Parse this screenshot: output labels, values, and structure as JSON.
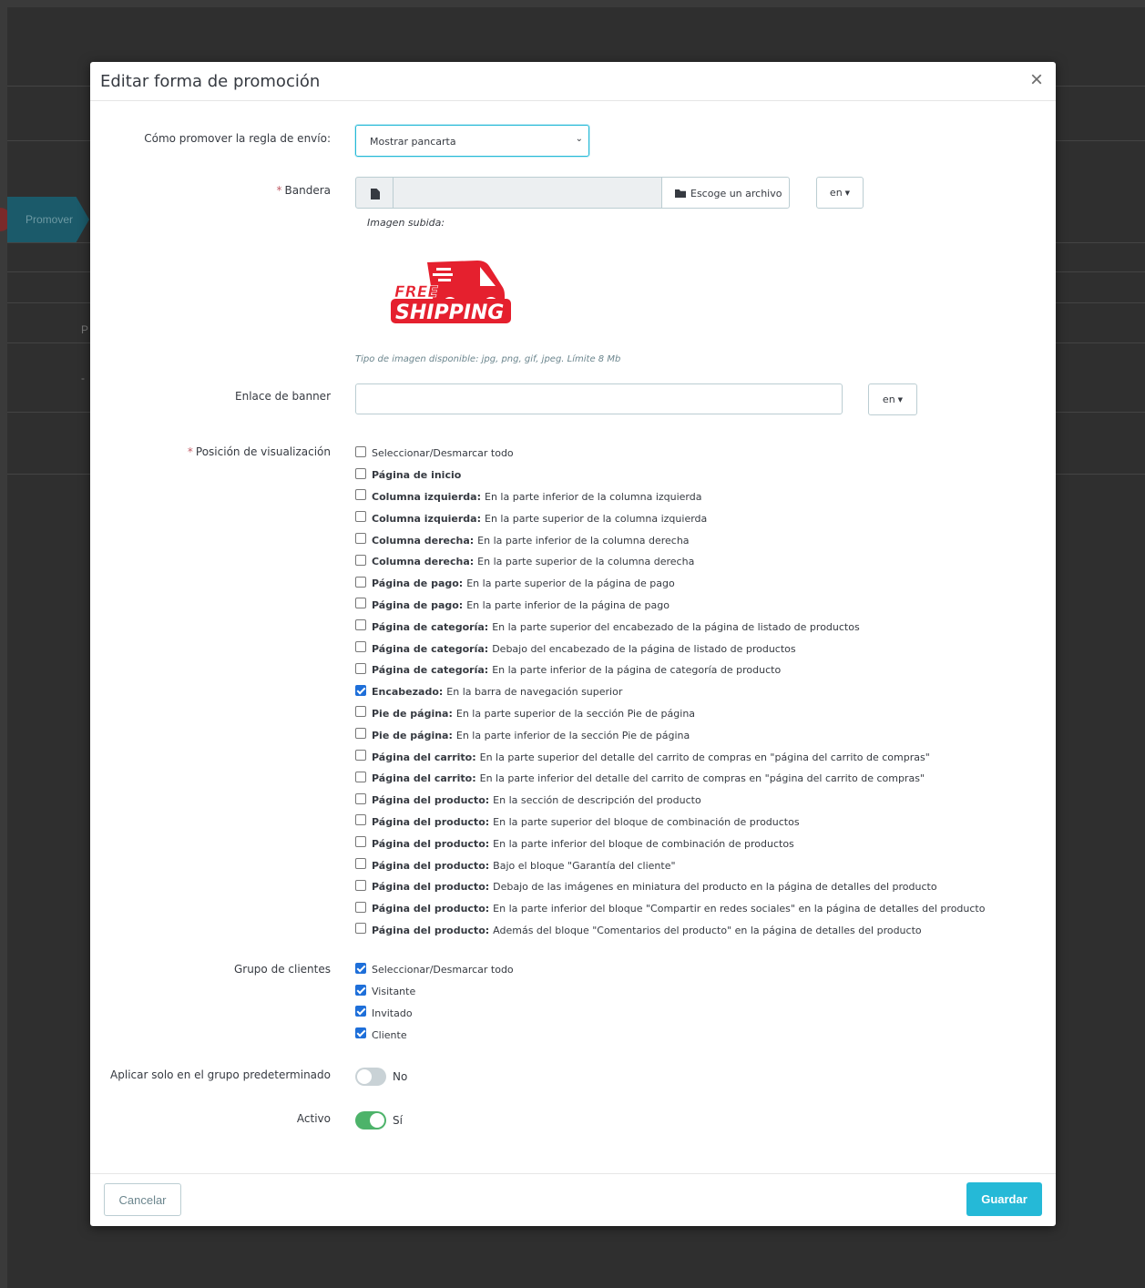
{
  "background": {
    "tab_label": "Promover",
    "fragment_left": "P",
    "fragment_dash": "-"
  },
  "modal": {
    "title": "Editar forma de promoción",
    "close_symbol": "×"
  },
  "form": {
    "promote_label": "Cómo promover la regla de envío:",
    "promote_select_value": "Mostrar pancarta",
    "banner_label": "Bandera",
    "file_button_label": "Escoge un archivo",
    "lang_code": "en",
    "uploaded_image_label": "Imagen subida:",
    "logo_text_free": "FREE",
    "logo_text_shipping": "SHIPPING",
    "image_help": "Tipo de imagen disponible: jpg, png, gif, jpeg. Límite 8 Mb",
    "banner_link_label": "Enlace de banner",
    "banner_link_value": "",
    "display_position_label": "Posición de visualización",
    "positions": [
      {
        "bold": "",
        "text": "Seleccionar/Desmarcar todo",
        "checked": false
      },
      {
        "bold": "Página de inicio",
        "text": "",
        "checked": false
      },
      {
        "bold": "Columna izquierda:",
        "text": "En la parte inferior de la columna izquierda",
        "checked": false
      },
      {
        "bold": "Columna izquierda:",
        "text": "En la parte superior de la columna izquierda",
        "checked": false
      },
      {
        "bold": "Columna derecha:",
        "text": "En la parte inferior de la columna derecha",
        "checked": false
      },
      {
        "bold": "Columna derecha:",
        "text": "En la parte superior de la columna derecha",
        "checked": false
      },
      {
        "bold": "Página de pago:",
        "text": "En la parte superior de la página de pago",
        "checked": false
      },
      {
        "bold": "Página de pago:",
        "text": "En la parte inferior de la página de pago",
        "checked": false
      },
      {
        "bold": "Página de categoría:",
        "text": "En la parte superior del encabezado de la página de listado de productos",
        "checked": false
      },
      {
        "bold": "Página de categoría:",
        "text": "Debajo del encabezado de la página de listado de productos",
        "checked": false
      },
      {
        "bold": "Página de categoría:",
        "text": "En la parte inferior de la página de categoría de producto",
        "checked": false
      },
      {
        "bold": "Encabezado:",
        "text": "En la barra de navegación superior",
        "checked": true
      },
      {
        "bold": "Pie de página:",
        "text": "En la parte superior de la sección Pie de página",
        "checked": false
      },
      {
        "bold": "Pie de página:",
        "text": "En la parte inferior de la sección Pie de página",
        "checked": false
      },
      {
        "bold": "Página del carrito:",
        "text": "En la parte superior del detalle del carrito de compras en \"página del carrito de compras\"",
        "checked": false
      },
      {
        "bold": "Página del carrito:",
        "text": "En la parte inferior del detalle del carrito de compras en \"página del carrito de compras\"",
        "checked": false
      },
      {
        "bold": "Página del producto:",
        "text": "En la sección de descripción del producto",
        "checked": false
      },
      {
        "bold": "Página del producto:",
        "text": "En la parte superior del bloque de combinación de productos",
        "checked": false
      },
      {
        "bold": "Página del producto:",
        "text": "En la parte inferior del bloque de combinación de productos",
        "checked": false
      },
      {
        "bold": "Página del producto:",
        "text": "Bajo el bloque \"Garantía del cliente\"",
        "checked": false
      },
      {
        "bold": "Página del producto:",
        "text": "Debajo de las imágenes en miniatura del producto en la página de detalles del producto",
        "checked": false
      },
      {
        "bold": "Página del producto:",
        "text": "En la parte inferior del bloque \"Compartir en redes sociales\" en la página de detalles del producto",
        "checked": false
      },
      {
        "bold": "Página del producto:",
        "text": "Además del bloque \"Comentarios del producto\" en la página de detalles del producto",
        "checked": false
      }
    ],
    "customer_group_label": "Grupo de clientes",
    "customer_groups": [
      {
        "text": "Seleccionar/Desmarcar todo",
        "checked": true
      },
      {
        "text": "Visitante",
        "checked": true
      },
      {
        "text": "Invitado",
        "checked": true
      },
      {
        "text": "Cliente",
        "checked": true
      }
    ],
    "default_group_label": "Aplicar solo en el grupo predeterminado",
    "default_group_value": "No",
    "default_group_on": false,
    "active_label": "Activo",
    "active_value": "Sí",
    "active_on": true
  },
  "footer": {
    "cancel_label": "Cancelar",
    "save_label": "Guardar"
  },
  "colors": {
    "primary": "#25b9d7",
    "checkbox_checked": "#1e6fd9",
    "switch_on": "#4db36a",
    "logo_red": "#e5202e"
  }
}
